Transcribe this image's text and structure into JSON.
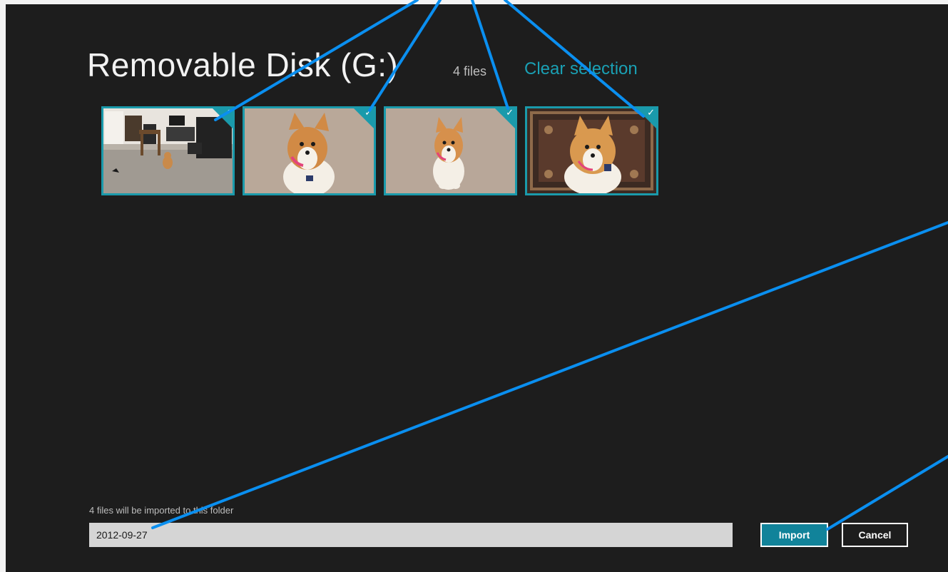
{
  "header": {
    "title": "Removable Disk (G:)",
    "file_count": "4 files",
    "clear_selection": "Clear selection"
  },
  "thumbnails": [
    {
      "subject": "room with dog",
      "selected": true,
      "check": "✓"
    },
    {
      "subject": "corgi on carpet",
      "selected": true,
      "check": "✓"
    },
    {
      "subject": "corgi on carpet",
      "selected": true,
      "check": "✓"
    },
    {
      "subject": "corgi on rug",
      "selected": true,
      "check": "✓"
    }
  ],
  "footer": {
    "folder_label": "4 files will be imported to this folder",
    "folder_value": "2012-09-27",
    "import_label": "Import",
    "cancel_label": "Cancel"
  },
  "colors": {
    "background": "#1d1d1d",
    "accent": "#1a9aab",
    "annotation": "#0a8ff0"
  }
}
